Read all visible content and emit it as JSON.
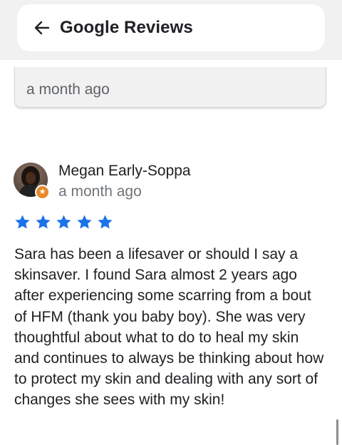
{
  "header": {
    "title": "Google Reviews",
    "back_icon": "arrow-left-icon"
  },
  "previous_review": {
    "time": "a month ago"
  },
  "review": {
    "reviewer_name": "Megan Early-Soppa",
    "time": "a month ago",
    "rating": 5,
    "rating_max": 5,
    "star_color": "#1a73e8",
    "badge_icon": "local-guide-star-icon",
    "text": "Sara has been a lifesaver or should I say a skinsaver. I found Sara almost 2 years ago after experiencing some scarring from a bout of HFM (thank you baby boy). She was very thoughtful about what to do to heal my skin and continues to always be thinking about how to protect my skin and dealing with any sort of changes she sees with my skin!"
  }
}
